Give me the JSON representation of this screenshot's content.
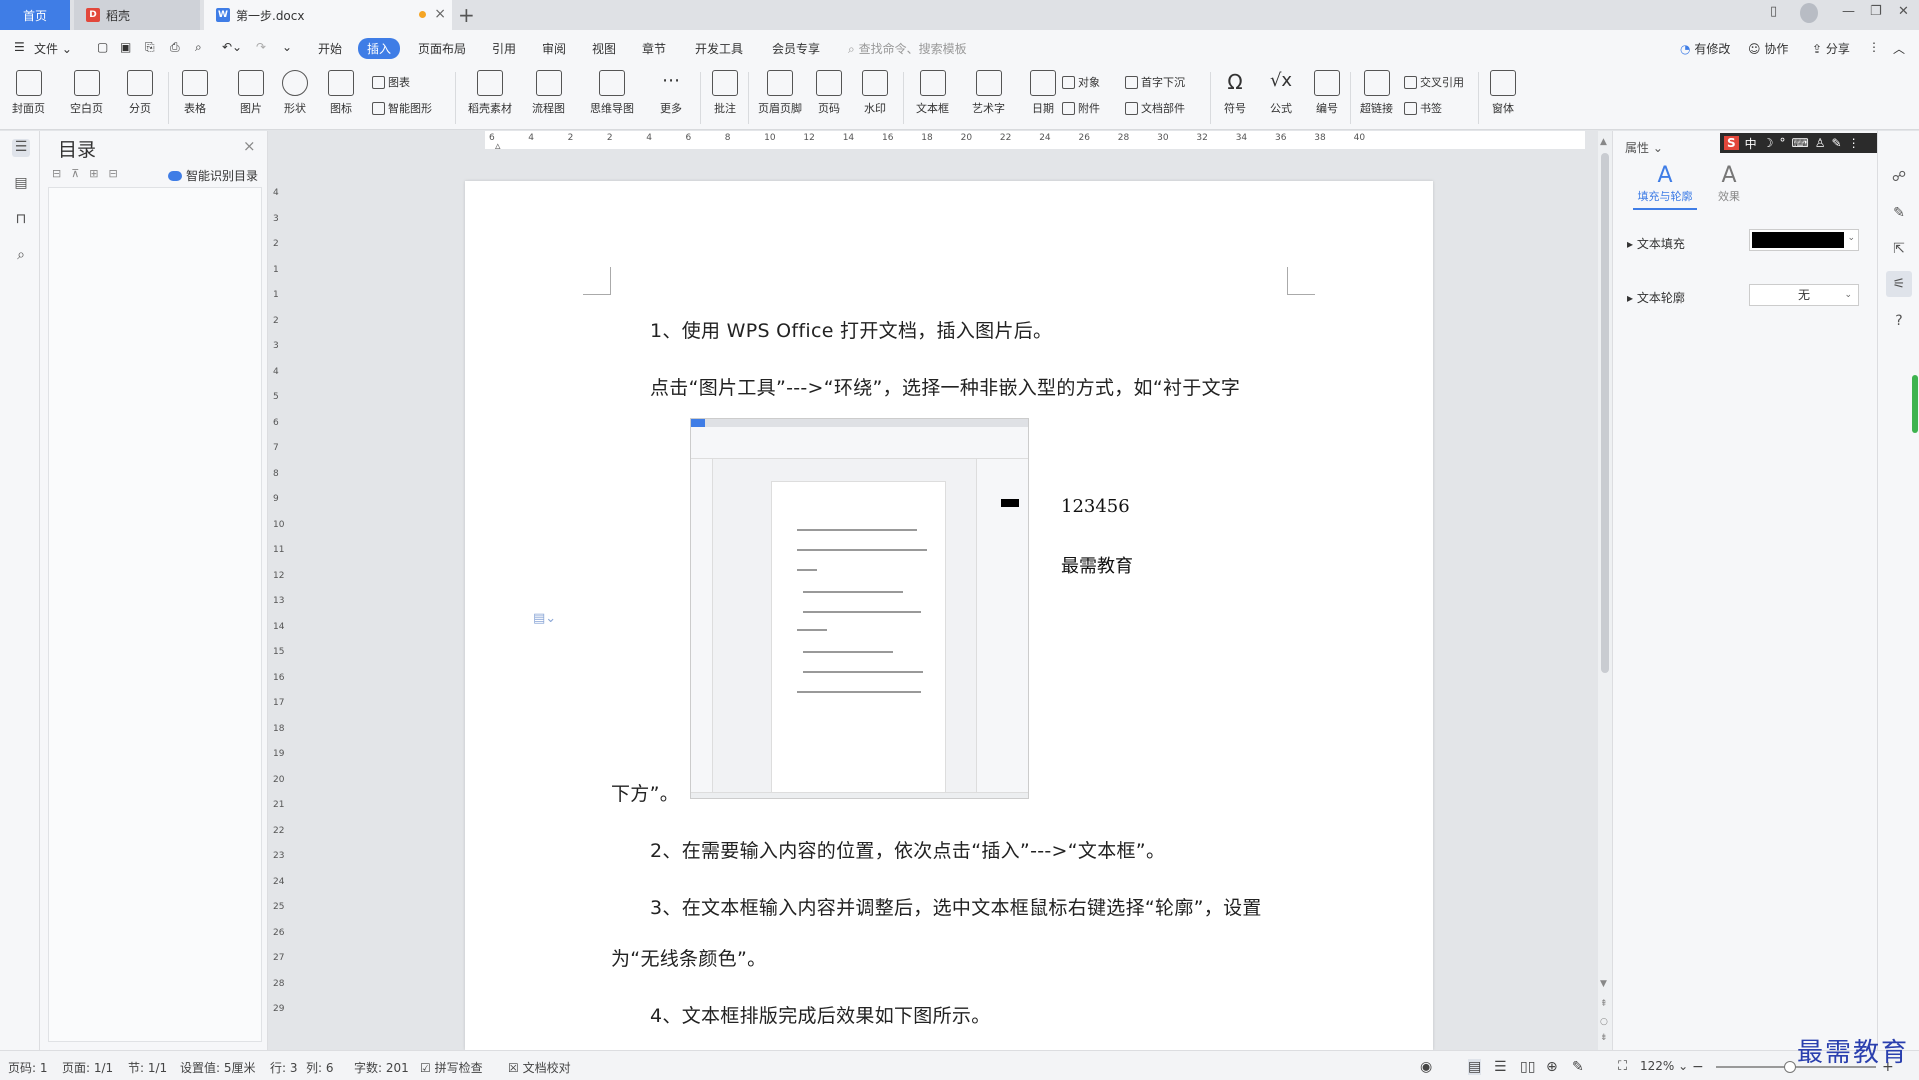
{
  "tabs": {
    "home": "首页",
    "daoke": "稻壳",
    "doc": "第一步.docx"
  },
  "menu": {
    "file": "文件",
    "items": [
      "开始",
      "插入",
      "页面布局",
      "引用",
      "审阅",
      "视图",
      "章节",
      "开发工具",
      "会员专享"
    ],
    "active": "插入",
    "search_placeholder": "查找命令、搜索模板",
    "modified": "有修改",
    "collab": "协作",
    "share": "分享"
  },
  "ribbon": {
    "big": [
      "封面页",
      "空白页",
      "分页",
      "表格",
      "图片",
      "形状",
      "图标",
      "稻壳素材",
      "流程图",
      "思维导图",
      "更多",
      "批注",
      "页眉页脚",
      "页码",
      "水印",
      "文本框",
      "艺术字",
      "日期",
      "符号",
      "公式",
      "编号",
      "超链接",
      "窗体"
    ],
    "small": {
      "chart": "图表",
      "smartart": "智能图形",
      "object": "对象",
      "dropcap": "首字下沉",
      "attach": "附件",
      "docpart": "文档部件",
      "crossref": "交叉引用",
      "bookmark": "书签"
    }
  },
  "toc": {
    "title": "目录",
    "smart": "智能识别目录"
  },
  "doc": {
    "p1": "1、使用 WPS Office 打开文档，插入图片后。",
    "p2a": "点击“图片工具”--->“环绕”，选择一种非嵌入型的方式，如“衬于文字",
    "p2b": "下方”。",
    "p3": "2、在需要输入内容的位置，依次点击“插入”--->“文本框”。",
    "p4a": "3、在文本框输入内容并调整后，选中文本框鼠标右键选择“轮廓”，设置",
    "p4b": "为“无线条颜色”。",
    "p5": "4、文本框排版完成后效果如下图所示。",
    "textbox1": "123456",
    "textbox2": "最需教育"
  },
  "props": {
    "title": "属性",
    "tab_fill": "填充与轮廓",
    "tab_effect": "效果",
    "text_fill": "文本填充",
    "text_outline": "文本轮廓",
    "outline_value": "无",
    "fill_color": "#000000"
  },
  "ime": {
    "lang": "中"
  },
  "status": {
    "page": "页码: 1",
    "pages": "页面: 1/1",
    "section": "节: 1/1",
    "setting": "设置值: 5厘米",
    "row": "行: 3",
    "col": "列: 6",
    "words": "字数: 201",
    "spell": "拼写检查",
    "proof": "文档校对",
    "zoom": "122%"
  },
  "watermark": "最需教育",
  "hruler_ticks": [
    "6",
    "4",
    "2",
    "2",
    "4",
    "6",
    "8",
    "10",
    "12",
    "14",
    "16",
    "18",
    "20",
    "22",
    "24",
    "26",
    "28",
    "30",
    "32",
    "34",
    "36",
    "38",
    "40"
  ],
  "vruler_ticks": [
    "4",
    "3",
    "2",
    "1",
    "1",
    "2",
    "3",
    "4",
    "5",
    "6",
    "7",
    "8",
    "9",
    "10",
    "11",
    "12",
    "13",
    "14",
    "15",
    "16",
    "17",
    "18",
    "19",
    "20",
    "21",
    "22",
    "23",
    "24",
    "25",
    "26",
    "27",
    "28",
    "29"
  ]
}
